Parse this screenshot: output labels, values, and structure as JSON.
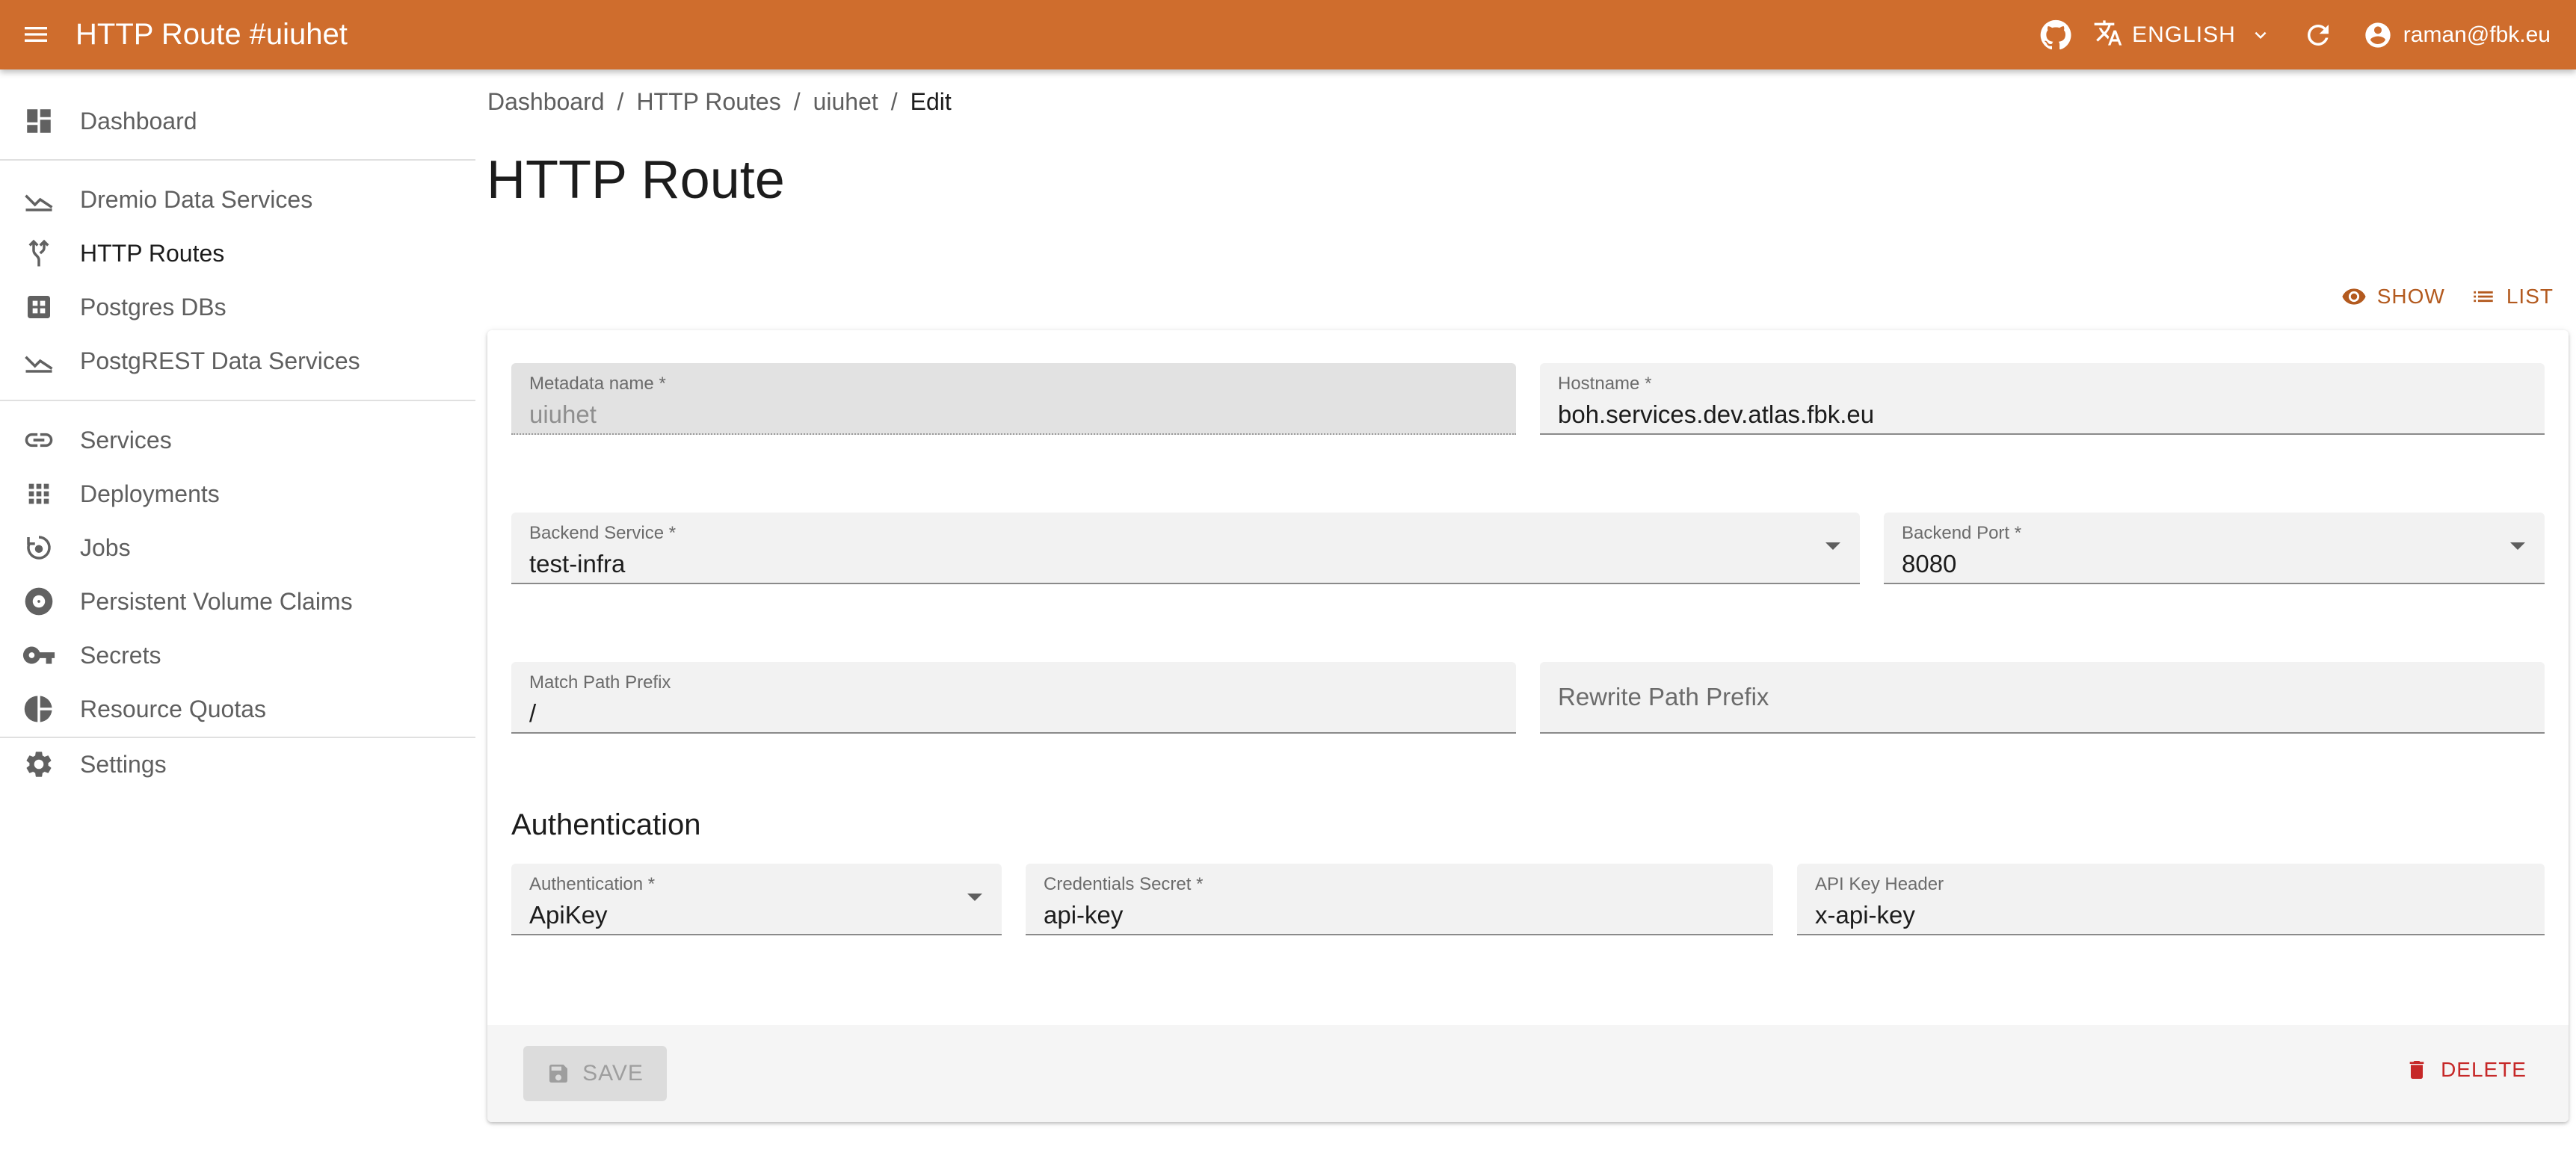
{
  "appbar": {
    "title": "HTTP Route #uiuhet",
    "language": "ENGLISH",
    "user": "raman@fbk.eu",
    "color": "#cf6d2d"
  },
  "sidebar": {
    "items": [
      {
        "label": "Dashboard",
        "icon": "dashboard-icon"
      },
      {
        "label": "Dremio Data Services",
        "icon": "chart-line-icon"
      },
      {
        "label": "HTTP Routes",
        "icon": "fork-icon"
      },
      {
        "label": "Postgres DBs",
        "icon": "grid-box-icon"
      },
      {
        "label": "PostgREST Data Services",
        "icon": "chart-line-icon"
      },
      {
        "label": "Services",
        "icon": "link-icon"
      },
      {
        "label": "Deployments",
        "icon": "apps-grid-icon"
      },
      {
        "label": "Jobs",
        "icon": "cycle-icon"
      },
      {
        "label": "Persistent Volume Claims",
        "icon": "disc-icon"
      },
      {
        "label": "Secrets",
        "icon": "key-icon"
      },
      {
        "label": "Resource Quotas",
        "icon": "pie-chart-icon"
      },
      {
        "label": "Settings",
        "icon": "gear-icon"
      }
    ]
  },
  "breadcrumb": {
    "items": [
      "Dashboard",
      "HTTP Routes",
      "uiuhet"
    ],
    "current": "Edit",
    "separator": "/"
  },
  "page": {
    "title": "HTTP Route"
  },
  "actions": {
    "show": "SHOW",
    "list": "LIST"
  },
  "form": {
    "metadata_name": {
      "label": "Metadata name",
      "required": "*",
      "value": "uiuhet"
    },
    "hostname": {
      "label": "Hostname",
      "required": "*",
      "value": "boh.services.dev.atlas.fbk.eu"
    },
    "backend_service": {
      "label": "Backend Service",
      "required": "*",
      "value": "test-infra"
    },
    "backend_port": {
      "label": "Backend Port",
      "required": "*",
      "value": "8080"
    },
    "match_path_prefix": {
      "label": "Match Path Prefix",
      "value": "/"
    },
    "rewrite_path_prefix": {
      "placeholder": "Rewrite Path Prefix"
    },
    "auth_section_title": "Authentication",
    "authentication": {
      "label": "Authentication",
      "required": "*",
      "value": "ApiKey"
    },
    "credentials_secret": {
      "label": "Credentials Secret",
      "required": "*",
      "value": "api-key"
    },
    "api_key_header": {
      "label": "API Key Header",
      "value": "x-api-key"
    }
  },
  "toolbar": {
    "save": "SAVE",
    "delete": "DELETE"
  }
}
